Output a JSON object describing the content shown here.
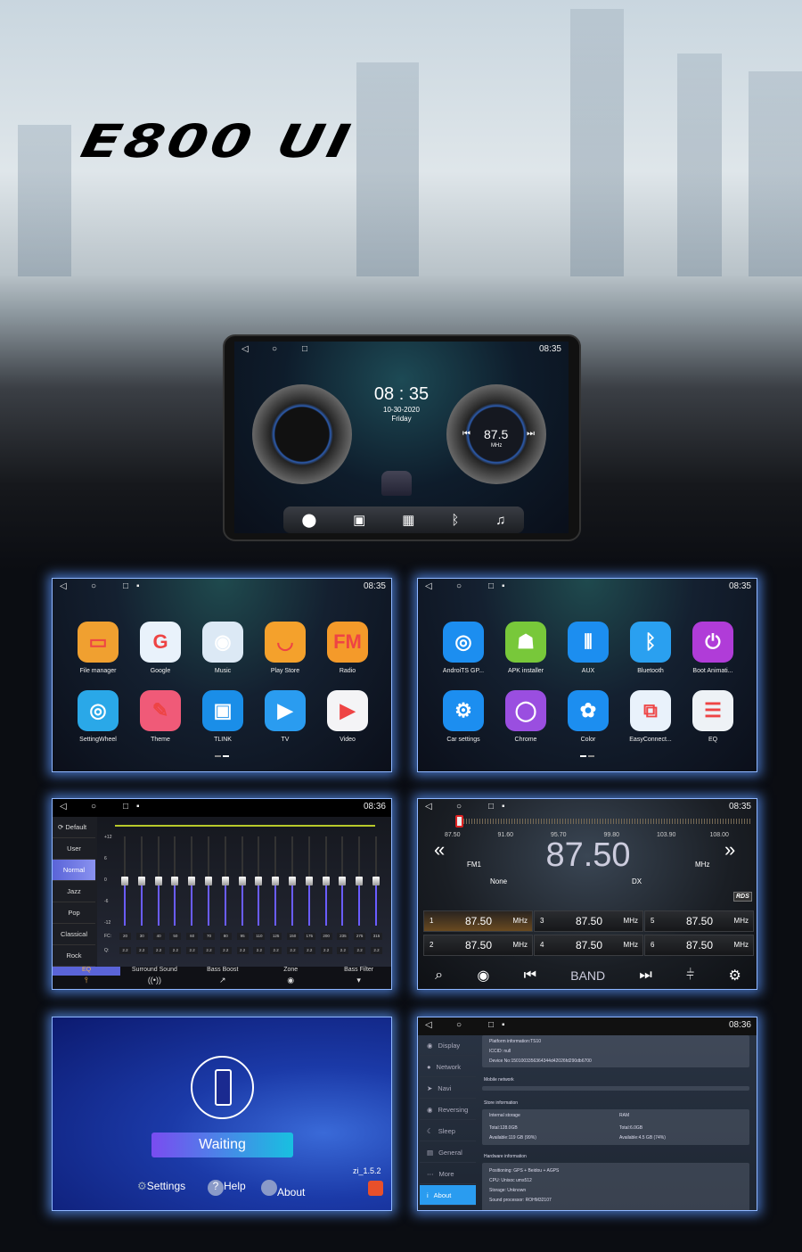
{
  "banner": {
    "title": "E800 UI"
  },
  "colors": {
    "accent_blue": "#3e8cf0",
    "eq_purple": "#6a5cff",
    "glow": "#5a96ff",
    "waiting_grad_start": "#7a4cf0",
    "waiting_grad_end": "#18c0e0"
  },
  "head_unit": {
    "status_time": "08:35",
    "clock": "08 : 35",
    "date": "10-30-2020",
    "weekday": "Friday",
    "radio_freq": "87.5",
    "radio_unit": "MHz",
    "dock": [
      "location-icon",
      "radio-icon",
      "apps-icon",
      "bluetooth-icon",
      "music-icon"
    ]
  },
  "launcher1": {
    "status_time": "08:35",
    "apps": [
      {
        "label": "File manager",
        "icon": "folder-icon",
        "color": "#f0a030"
      },
      {
        "label": "Google",
        "icon": "google-icon",
        "color": "#e9f2fb"
      },
      {
        "label": "Music",
        "icon": "record-icon",
        "color": "#dce9f5"
      },
      {
        "label": "Play Store",
        "icon": "bag-icon",
        "color": "#f4a12c"
      },
      {
        "label": "Radio",
        "icon": "radio-icon",
        "color": "#f49a2a"
      },
      {
        "label": "SettingWheel",
        "icon": "steering-wheel-icon",
        "color": "#2aa8e8"
      },
      {
        "label": "Theme",
        "icon": "brush-icon",
        "color": "#f05a78"
      },
      {
        "label": "TLINK",
        "icon": "tlink-icon",
        "color": "#1a8ee8"
      },
      {
        "label": "TV",
        "icon": "play-icon",
        "color": "#2a9cf0"
      },
      {
        "label": "Video",
        "icon": "video-icon",
        "color": "#f4f4f6"
      }
    ]
  },
  "launcher2": {
    "status_time": "08:35",
    "apps": [
      {
        "label": "AndroiTS GP...",
        "icon": "radar-icon",
        "color": "#1c8ef0"
      },
      {
        "label": "APK installer",
        "icon": "android-icon",
        "color": "#78c83a"
      },
      {
        "label": "AUX",
        "icon": "aux-cable-icon",
        "color": "#1c8ef0"
      },
      {
        "label": "Bluetooth",
        "icon": "bluetooth-icon",
        "color": "#2aa0f0"
      },
      {
        "label": "Boot Animati...",
        "icon": "power-icon",
        "color": "#b03cd8"
      },
      {
        "label": "Car settings",
        "icon": "car-gear-icon",
        "color": "#1c8ef0"
      },
      {
        "label": "Chrome",
        "icon": "ring-icon",
        "color": "#9a4ee0"
      },
      {
        "label": "Color",
        "icon": "flower-icon",
        "color": "#1c8ef0"
      },
      {
        "label": "EasyConnect...",
        "icon": "connect-icon",
        "color": "#e9f2fb"
      },
      {
        "label": "EQ",
        "icon": "toggle-icon",
        "color": "#eef2f6"
      }
    ]
  },
  "eq": {
    "status_time": "08:36",
    "default_label": "Default",
    "presets": [
      "User",
      "Normal",
      "Jazz",
      "Pop",
      "Classical",
      "Rock"
    ],
    "selected_preset": "Normal",
    "y_ticks": [
      "+12",
      "6",
      "0",
      "-6",
      "-12"
    ],
    "fc_label": "FC:",
    "q_label": "Q:",
    "fc": [
      "20",
      "30",
      "40",
      "50",
      "60",
      "70",
      "80",
      "95",
      "110",
      "125",
      "150",
      "175",
      "200",
      "235",
      "275",
      "315"
    ],
    "q": [
      "2.2",
      "2.2",
      "2.2",
      "2.2",
      "2.2",
      "2.2",
      "2.2",
      "2.2",
      "2.2",
      "2.2",
      "2.2",
      "2.2",
      "2.2",
      "2.2",
      "2.2",
      "2.2"
    ],
    "gains_db": [
      0,
      0,
      0,
      0,
      0,
      0,
      0,
      0,
      0,
      0,
      0,
      0,
      0,
      0,
      0,
      0
    ],
    "tabs": [
      {
        "label": "EQ",
        "icon": "equalizer-icon"
      },
      {
        "label": "Surround Sound",
        "icon": "surround-icon"
      },
      {
        "label": "Bass Boost",
        "icon": "bass-boost-icon"
      },
      {
        "label": "Zone",
        "icon": "zone-icon"
      },
      {
        "label": "Bass Filter",
        "icon": "bass-filter-icon"
      }
    ],
    "active_tab": "EQ"
  },
  "radio": {
    "status_time": "08:35",
    "scale": [
      "87.50",
      "91.60",
      "95.70",
      "99.80",
      "103.90",
      "108.00"
    ],
    "frequency": "87.50",
    "band": "FM1",
    "unit": "MHz",
    "ps": "None",
    "mode": "DX",
    "rds": "RDS",
    "presets": [
      {
        "n": "1",
        "f": "87.50",
        "u": "MHz"
      },
      {
        "n": "2",
        "f": "87.50",
        "u": "MHz"
      },
      {
        "n": "3",
        "f": "87.50",
        "u": "MHz"
      },
      {
        "n": "4",
        "f": "87.50",
        "u": "MHz"
      },
      {
        "n": "5",
        "f": "87.50",
        "u": "MHz"
      },
      {
        "n": "6",
        "f": "87.50",
        "u": "MHz"
      }
    ],
    "band_label": "BAND"
  },
  "carplay": {
    "status": "Waiting",
    "version": "zi_1.5.2",
    "settings": "Settings",
    "help": "Help",
    "about": "About"
  },
  "settings": {
    "status_time": "08:36",
    "menu": [
      "Display",
      "Network",
      "Navi",
      "Reversing",
      "Sleep",
      "General",
      "More",
      "About"
    ],
    "active": "About",
    "platform": "Platform information:TS10",
    "iccid": "ICCID:  null",
    "device": "Device No:1501003356364344d42026fd290db6700",
    "mobile_network": "Mobile network",
    "store_info": "Store information",
    "internal_storage": "Internal storage",
    "ram": "RAM",
    "storage_total": "Total:128.0GB",
    "storage_avail": "Available:119 GB (99%)",
    "ram_total": "Total:6.0GB",
    "ram_avail": "Available:4.5 GB (74%)",
    "hardware_info": "Hardware information",
    "positioning": "Positioning: GPS + Beidou + AGPS",
    "cpu": "CPU:   Unisoc ums512",
    "storage": "Storage: Unknown",
    "sound": "Sound processor:  ROHM32107"
  }
}
